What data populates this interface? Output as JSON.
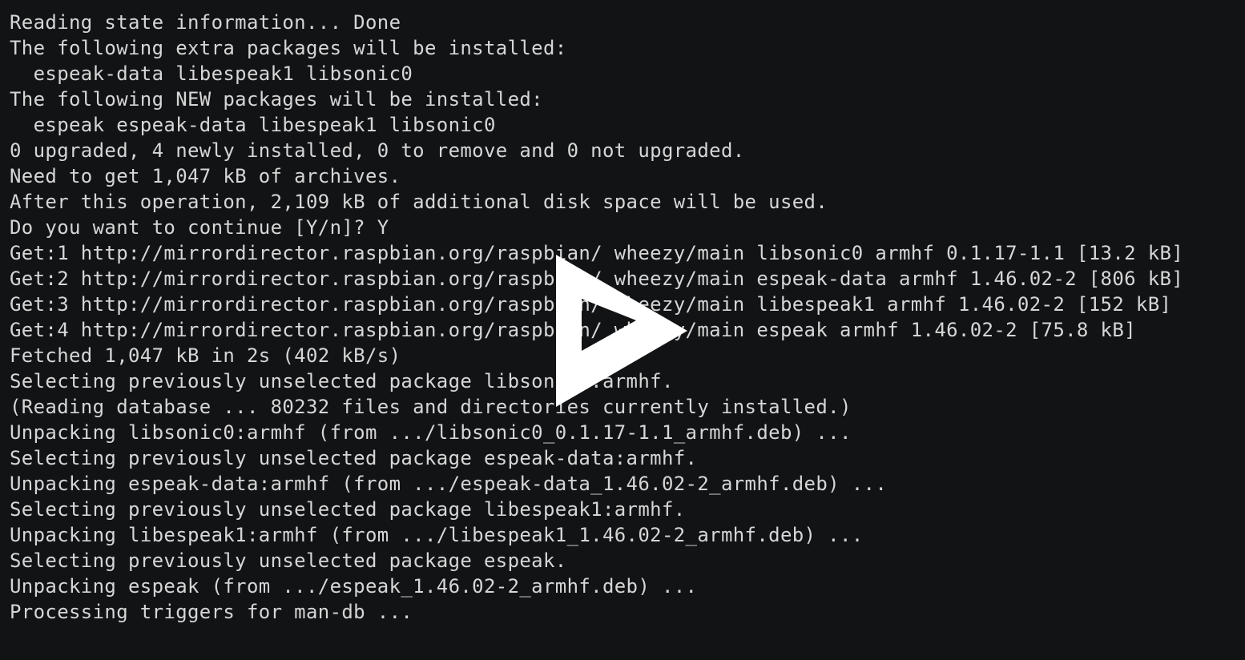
{
  "terminal": {
    "lines": [
      "Reading state information... Done",
      "The following extra packages will be installed:",
      "  espeak-data libespeak1 libsonic0",
      "The following NEW packages will be installed:",
      "  espeak espeak-data libespeak1 libsonic0",
      "0 upgraded, 4 newly installed, 0 to remove and 0 not upgraded.",
      "Need to get 1,047 kB of archives.",
      "After this operation, 2,109 kB of additional disk space will be used.",
      "Do you want to continue [Y/n]? Y",
      "Get:1 http://mirrordirector.raspbian.org/raspbian/ wheezy/main libsonic0 armhf 0.1.17-1.1 [13.2 kB]",
      "Get:2 http://mirrordirector.raspbian.org/raspbian/ wheezy/main espeak-data armhf 1.46.02-2 [806 kB]",
      "Get:3 http://mirrordirector.raspbian.org/raspbian/ wheezy/main libespeak1 armhf 1.46.02-2 [152 kB]",
      "Get:4 http://mirrordirector.raspbian.org/raspbian/ wheezy/main espeak armhf 1.46.02-2 [75.8 kB]",
      "Fetched 1,047 kB in 2s (402 kB/s)",
      "Selecting previously unselected package libsonic0:armhf.",
      "(Reading database ... 80232 files and directories currently installed.)",
      "Unpacking libsonic0:armhf (from .../libsonic0_0.1.17-1.1_armhf.deb) ...",
      "Selecting previously unselected package espeak-data:armhf.",
      "Unpacking espeak-data:armhf (from .../espeak-data_1.46.02-2_armhf.deb) ...",
      "Selecting previously unselected package libespeak1:armhf.",
      "Unpacking libespeak1:armhf (from .../libespeak1_1.46.02-2_armhf.deb) ...",
      "Selecting previously unselected package espeak.",
      "Unpacking espeak (from .../espeak_1.46.02-2_armhf.deb) ...",
      "Processing triggers for man-db ..."
    ]
  },
  "overlay": {
    "icon": "play-icon",
    "color": "#ffffff"
  },
  "colors": {
    "background": "#121315",
    "text": "#d6d6d6"
  }
}
